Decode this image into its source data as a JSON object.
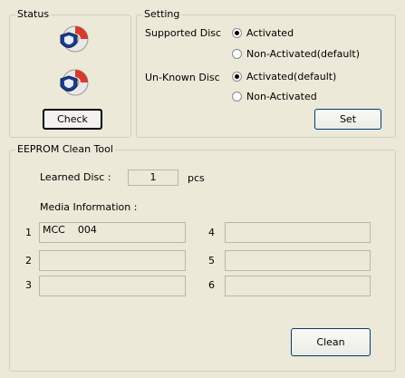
{
  "status": {
    "title": "Status",
    "icons": [
      "protected-disc-icon",
      "protected-disc-icon"
    ],
    "check_label": "Check"
  },
  "setting": {
    "title": "Setting",
    "supported_label": "Supported Disc",
    "supported_options": [
      "Activated",
      "Non-Activated(default)"
    ],
    "supported_selected": 0,
    "unknown_label": "Un-Known Disc",
    "unknown_options": [
      "Activated(default)",
      "Non-Activated"
    ],
    "unknown_selected": 0,
    "set_label": "Set"
  },
  "eeprom": {
    "title": "EEPROM Clean Tool",
    "learned_label": "Learned Disc :",
    "learned_value": "1",
    "learned_unit": "pcs",
    "media_label": "Media Information :",
    "media": [
      {
        "index": "1",
        "value": "MCC    004"
      },
      {
        "index": "2",
        "value": ""
      },
      {
        "index": "3",
        "value": ""
      },
      {
        "index": "4",
        "value": ""
      },
      {
        "index": "5",
        "value": ""
      },
      {
        "index": "6",
        "value": ""
      }
    ],
    "clean_label": "Clean"
  },
  "colors": {
    "background": "#ece9d8",
    "disc_red": "#d83a2c",
    "shield_blue": "#1c3d8f"
  }
}
